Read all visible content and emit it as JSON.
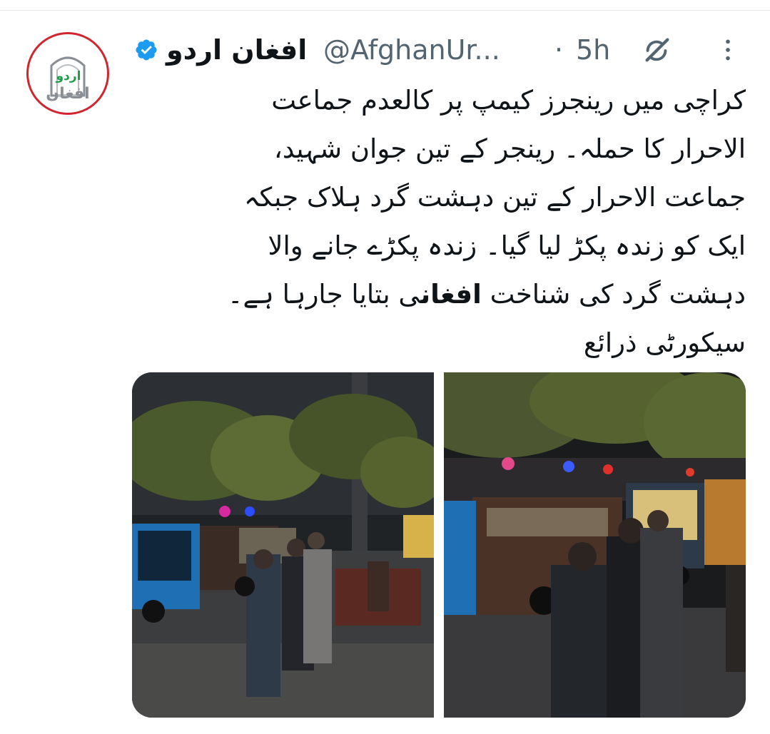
{
  "tweet": {
    "author": {
      "display_name": "افغان اردو",
      "handle": "@AfghanUr...",
      "verified": true,
      "avatar_text_top": "اردو",
      "avatar_text_bottom": "افغان"
    },
    "separator": "·",
    "time": "5h",
    "text_lines": [
      "کراچی میں رینجرز کیمپ پر کالعدم جماعت",
      "الاحرار کا حملہ۔ رینجر کے تین جوان شہید،",
      "جماعت الاحرار کے تین دہشت گرد ہلاک جبکہ",
      "ایک کو زندہ پکڑ لیا گیا۔ زندہ پکڑے جانے والا"
    ],
    "line5": {
      "before": "دہشت گرد کی شناخت ",
      "bold": "افغان",
      "after": "ی بتایا جارہا ہے۔"
    },
    "line6": "سیکورٹی ذرائع",
    "media": [
      {
        "name": "photo-1"
      },
      {
        "name": "photo-2"
      }
    ]
  },
  "colors": {
    "verified_blue": "#1d9bf0",
    "avatar_ring": "#d1262f",
    "avatar_green": "#1f9b4b",
    "avatar_grey": "#8a8f96",
    "secondary_text": "#536471",
    "primary_text": "#0f1419"
  },
  "icons": {
    "verified": "verified-badge-icon",
    "grok": "grok-icon",
    "more": "more-options-icon"
  }
}
